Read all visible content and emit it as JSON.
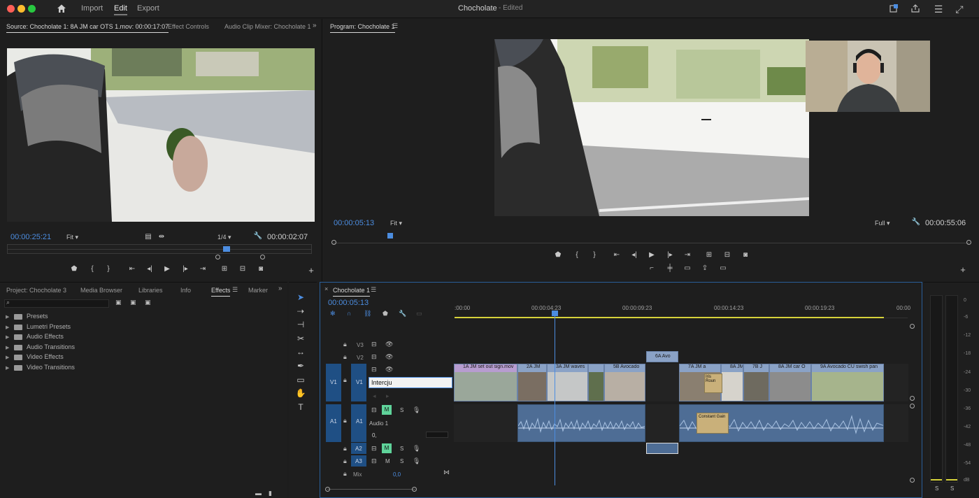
{
  "titlebar": {
    "tabs": [
      "Import",
      "Edit",
      "Export"
    ],
    "active_tab": "Edit",
    "project_title": "Chocholate",
    "project_status": "- Edited"
  },
  "source_monitor": {
    "tabs": [
      "Source: Chocholate 1: 8A JM car OTS 1.mov: 00:00:17:07",
      "Effect Controls",
      "Audio Clip Mixer: Chocholate 1"
    ],
    "timecode": "00:00:25:21",
    "fit": "Fit",
    "resolution": "1/4",
    "duration": "00:00:02:07",
    "playhead_fraction": 0.72
  },
  "program_monitor": {
    "title": "Program: Chocholate 1",
    "timecode": "00:00:05:13",
    "fit": "Fit",
    "resolution": "Full",
    "duration": "00:00:55:06",
    "playhead_fraction": 0.09
  },
  "project_panel": {
    "tabs": [
      "Project: Chocholate 3",
      "Media Browser",
      "Libraries",
      "Info",
      "Effects",
      "Marker"
    ],
    "active_tab": "Effects",
    "search_placeholder": "",
    "items": [
      "Presets",
      "Lumetri Presets",
      "Audio Effects",
      "Audio Transitions",
      "Video Effects",
      "Video Transitions"
    ]
  },
  "timeline": {
    "title": "Chocholate 1",
    "timecode": "00:00:05:13",
    "ruler": [
      ":00:00",
      "00:00:04:23",
      "00:00:09:23",
      "00:00:14:23",
      "00:00:19:23",
      "00:00"
    ],
    "tracks": {
      "v3": "V3",
      "v2": "V2",
      "v1": "V1",
      "v1_src": "V1",
      "a1": "A1",
      "a1_src": "A1",
      "a1_name": "Audio 1",
      "a2": "A2",
      "a3": "A3",
      "mix_label": "Mix",
      "mix_value": "0,0",
      "a1_volume": "0,"
    },
    "rename_input": "Intercju",
    "v2_clip": "6A Avo",
    "v1_clips": [
      "1A JM set out sign.mov",
      "2A JM",
      "3A JM waves",
      "",
      "5B Avocado",
      "7A JM a",
      "8A JM",
      "7B J",
      "8A JM car O",
      "9A Avocado CU swish pan"
    ],
    "overlay_labels": [
      "Iris Roun",
      "Constant Gain"
    ],
    "mute_label": "M",
    "solo_label": "S"
  },
  "meters": {
    "scale": [
      "0",
      "-6",
      "-12",
      "-18",
      "-24",
      "-30",
      "-36",
      "-42",
      "-48",
      "-54",
      "dB"
    ],
    "solo_labels": [
      "S",
      "S"
    ]
  }
}
